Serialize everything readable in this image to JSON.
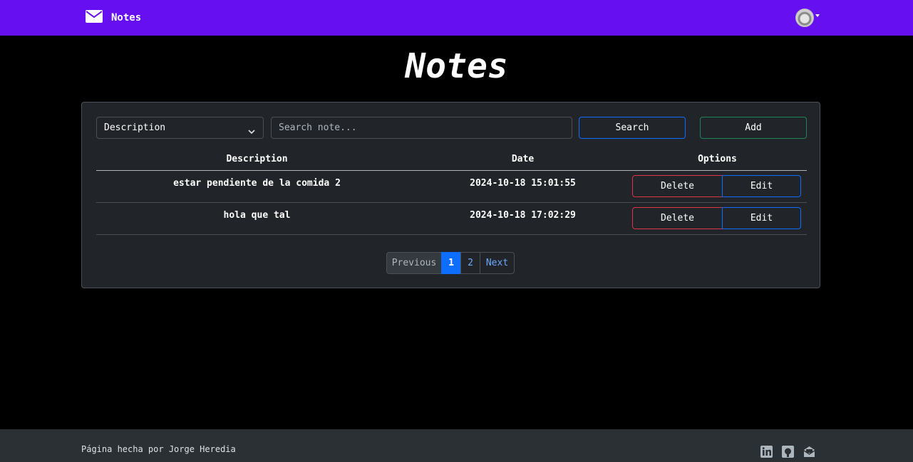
{
  "navbar": {
    "brand_label": "Notes",
    "brand_icon": "envelope-icon",
    "brand_color": "#6610f2"
  },
  "page": {
    "title": "Notes"
  },
  "filters": {
    "select_value": "Description",
    "search_placeholder": "Search note...",
    "search_label": "Search",
    "add_label": "Add"
  },
  "table": {
    "headers": [
      "Description",
      "Date",
      "Options"
    ],
    "rows": [
      {
        "description": "estar pendiente de la comida 2",
        "date": "2024-10-18 15:01:55",
        "delete_label": "Delete",
        "edit_label": "Edit"
      },
      {
        "description": "hola que tal",
        "date": "2024-10-18 17:02:29",
        "delete_label": "Delete",
        "edit_label": "Edit"
      }
    ]
  },
  "pagination": {
    "previous_label": "Previous",
    "pages": [
      "1",
      "2"
    ],
    "next_label": "Next",
    "current_page": 1
  },
  "footer": {
    "text": "Página hecha por Jorge Heredia",
    "icons": [
      "linkedin-icon",
      "github-icon",
      "mail-icon"
    ]
  }
}
